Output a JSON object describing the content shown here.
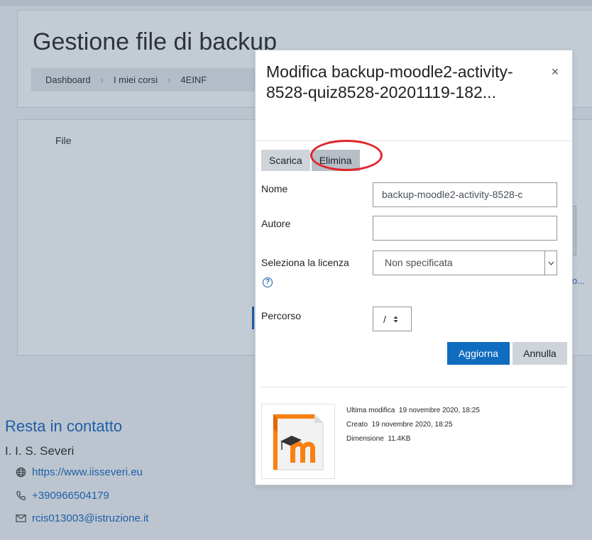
{
  "page": {
    "title": "Gestione file di backup",
    "breadcrumb": [
      "Dashboard",
      "I miei corsi",
      "4EINF"
    ],
    "file_column_label": "File",
    "behind_text": "o..."
  },
  "footer": {
    "title": "Resta in contatto",
    "org": "I. I. S. Severi",
    "website": "https://www.iisseveri.eu",
    "phone": "+390966504179",
    "email": "rcis013003@istruzione.it"
  },
  "modal": {
    "title": "Modifica backup-moodle2-activity-8528-quiz8528-20201119-182...",
    "close_label": "×",
    "tabs": [
      {
        "label": "Scarica",
        "active": false
      },
      {
        "label": "Elimina",
        "active": true
      }
    ],
    "fields": {
      "name_label": "Nome",
      "name_value": "backup-moodle2-activity-8528-c",
      "author_label": "Autore",
      "author_value": "",
      "license_label": "Seleziona la licenza",
      "license_value": "Non specificata",
      "path_label": "Percorso",
      "path_value": "/"
    },
    "buttons": {
      "update": "Aggiorna",
      "cancel": "Annulla"
    },
    "meta": {
      "modified_label": "Ultima modifica",
      "modified_value": "19 novembre 2020, 18:25",
      "created_label": "Creato",
      "created_value": "19 novembre 2020, 18:25",
      "size_label": "Dimensione",
      "size_value": "11.4KB"
    }
  },
  "colors": {
    "primary": "#0f6cbf",
    "link": "#1e5ea8",
    "highlight": "#e0262a",
    "moodle_orange": "#f98012"
  },
  "icons": {
    "file_thumb": "moodle-backup-file-icon",
    "website": "globe-icon",
    "phone": "phone-icon",
    "email": "envelope-icon",
    "help": "question-circle-icon"
  }
}
